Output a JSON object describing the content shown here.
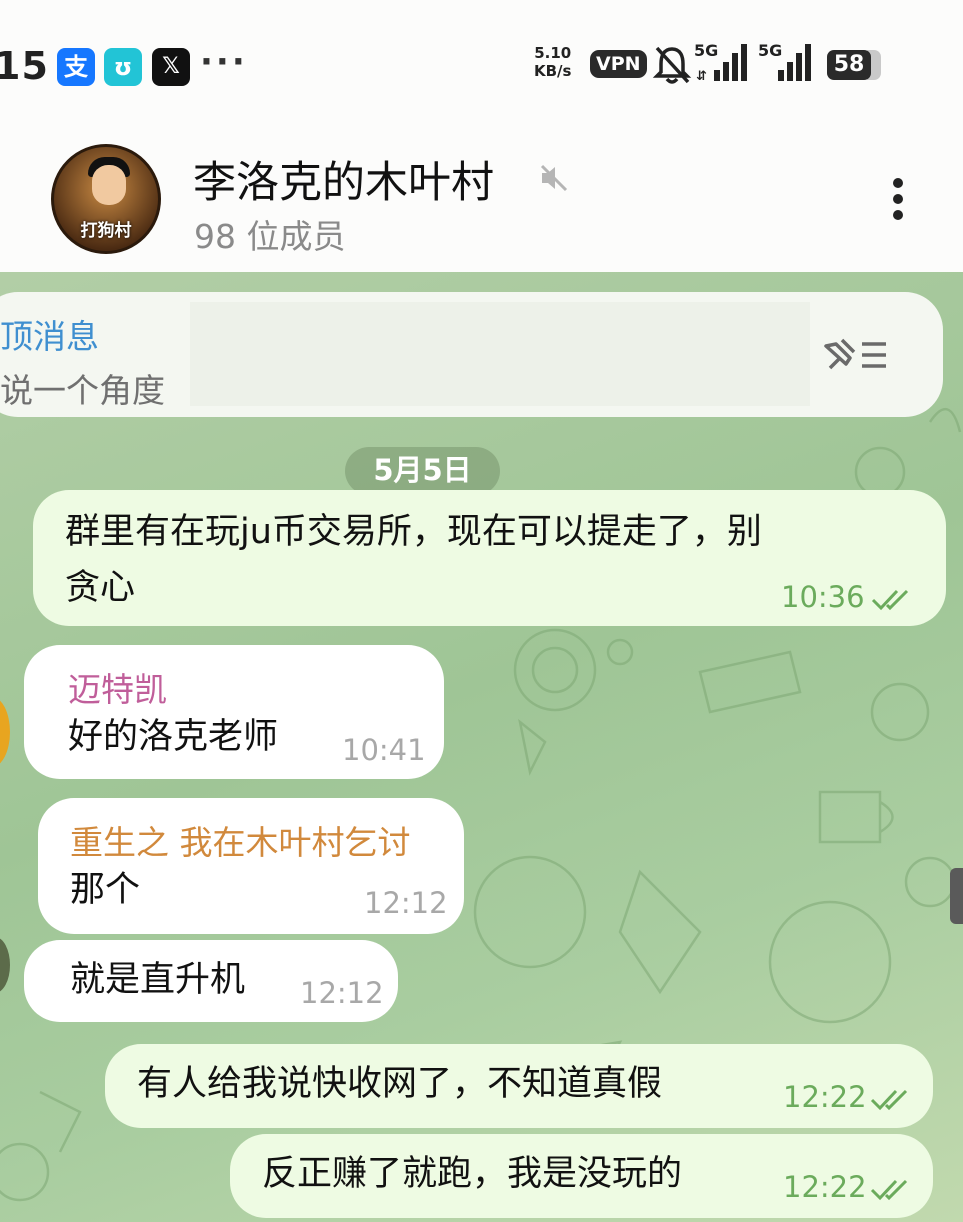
{
  "status_bar": {
    "time": "15",
    "apps": [
      {
        "icon": "alipay-icon",
        "glyph": "支",
        "color": "#1677ff"
      },
      {
        "icon": "app-icon",
        "glyph": "ʊ",
        "color": "#22c4d6"
      },
      {
        "icon": "x-icon",
        "glyph": "𝕏",
        "color": "#111111"
      }
    ],
    "more": "···",
    "net_speed_value": "5.10",
    "net_speed_unit": "KB/s",
    "vpn": "VPN",
    "signal_label": "5G",
    "battery": "58"
  },
  "header": {
    "avatar_text": "打狗村",
    "title": "李洛克的木叶村",
    "members": "98 位成员"
  },
  "pinned": {
    "title": "顶消息",
    "text": "说一个角度"
  },
  "date_badge": "5月5日",
  "colors": {
    "accent": "#3f8fd0",
    "outgoing_bubble": "#eefbe3",
    "outgoing_time": "#6bab5c",
    "sender_pink": "#c05e9a",
    "sender_orange": "#d1893c"
  },
  "messages": [
    {
      "direction": "out",
      "lines": [
        "群里有在玩ju币交易所，现在可以提走了，别",
        "贪心"
      ],
      "time": "10:36",
      "read": true
    },
    {
      "direction": "in",
      "sender": "迈特凯",
      "text": "好的洛克老师",
      "time": "10:41"
    },
    {
      "direction": "in",
      "sender": "重生之 我在木叶村乞讨",
      "text": "那个",
      "time": "12:12"
    },
    {
      "direction": "in",
      "text": "就是直升机",
      "time": "12:12"
    },
    {
      "direction": "out",
      "text": "有人给我说快收网了，不知道真假",
      "time": "12:22",
      "read": true
    },
    {
      "direction": "out",
      "text": "反正赚了就跑，我是没玩的",
      "time": "12:22",
      "read": true
    }
  ]
}
